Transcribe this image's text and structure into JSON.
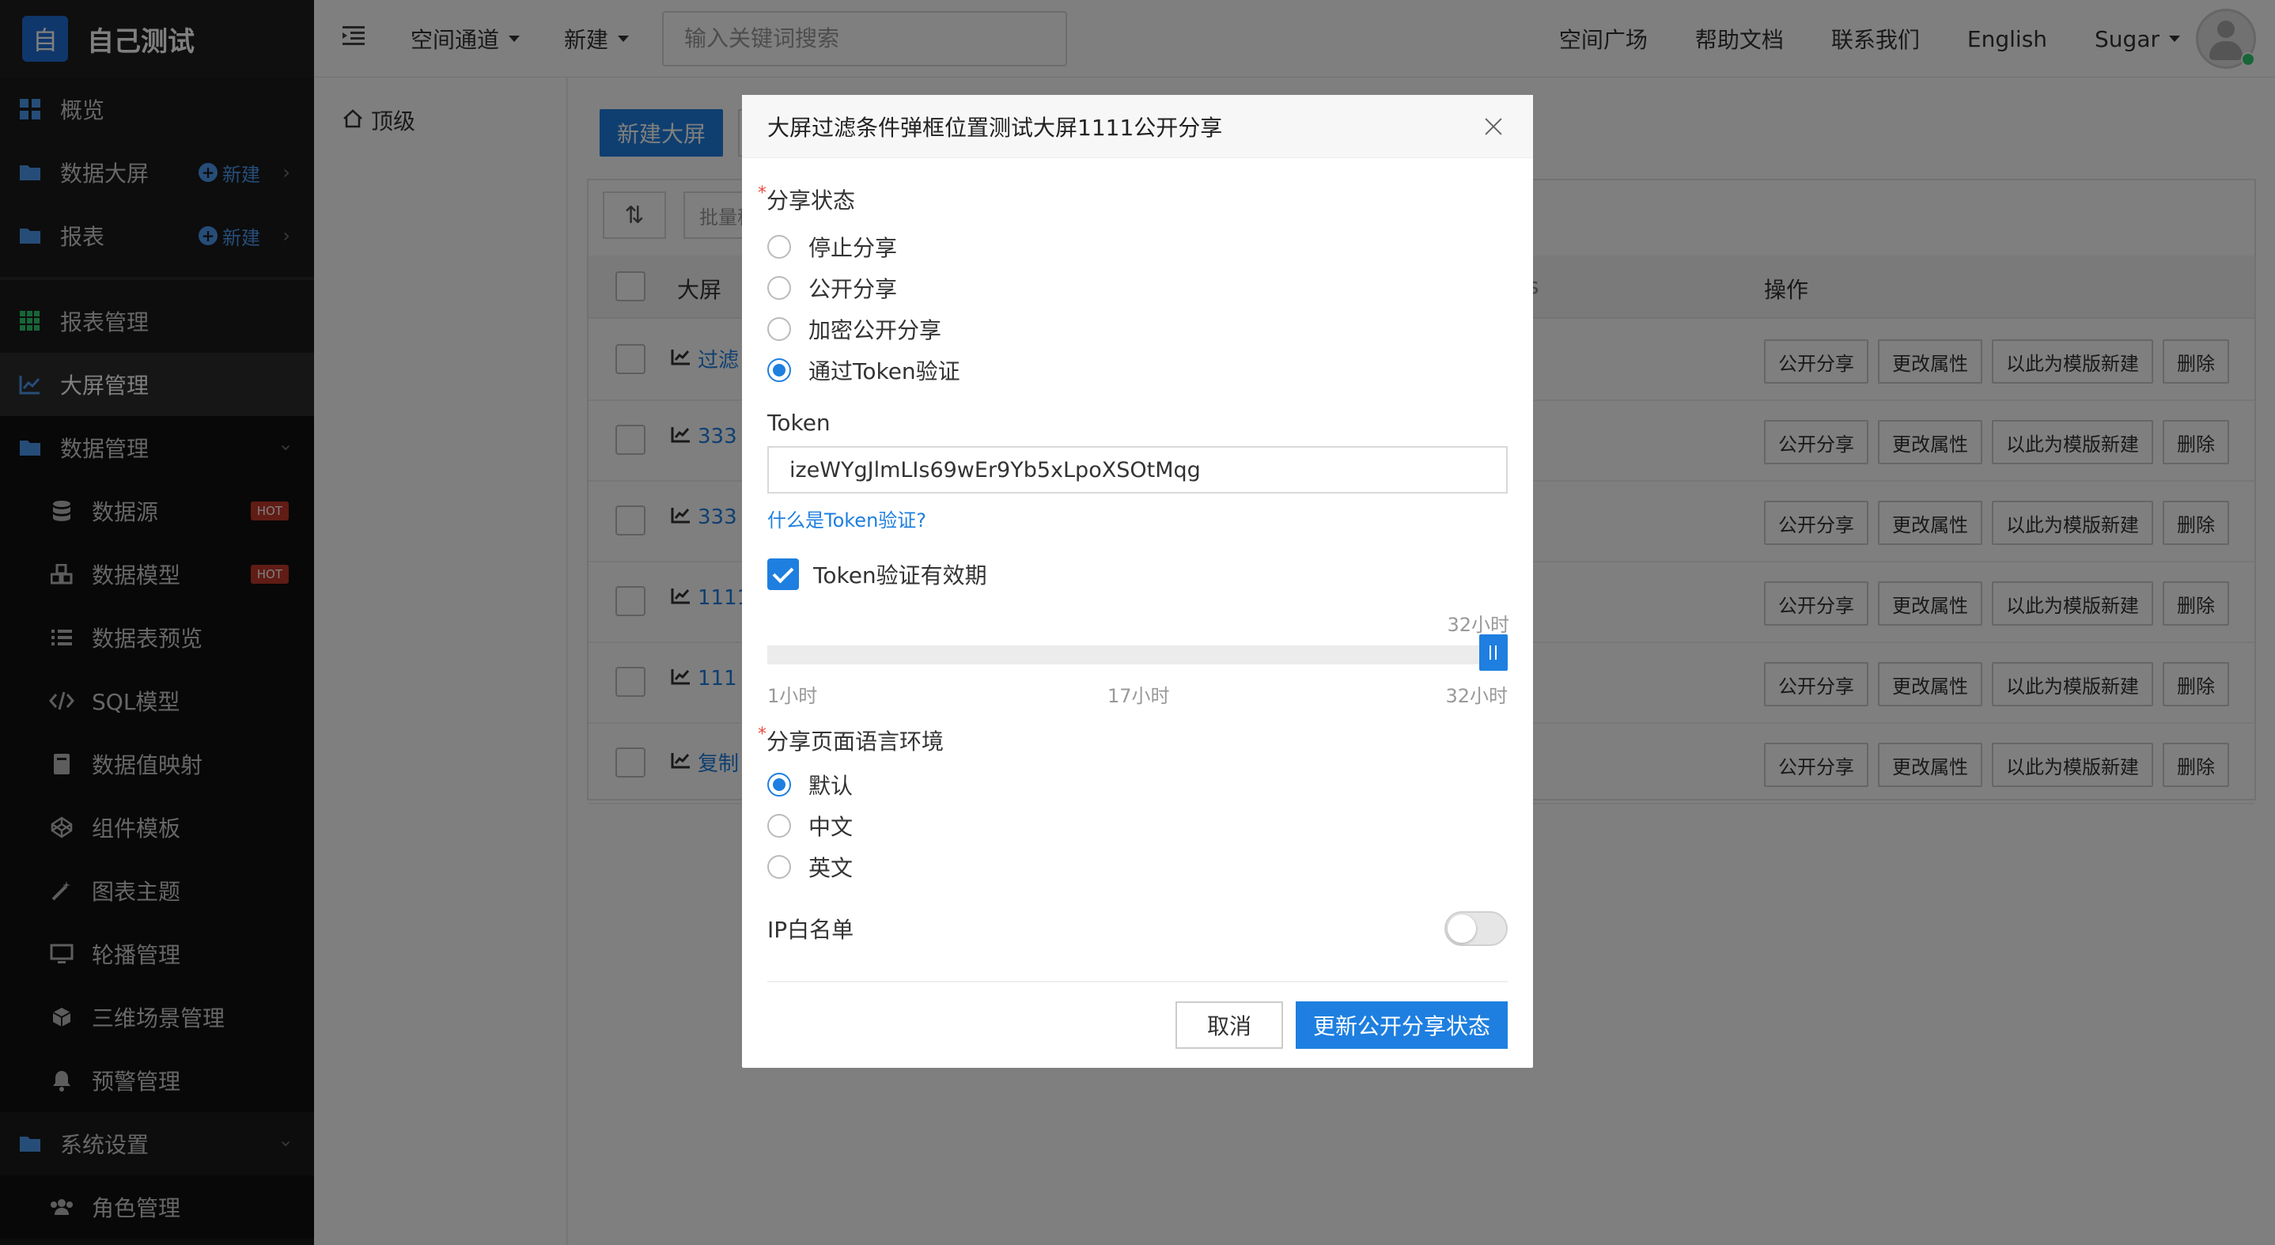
{
  "app": {
    "logo_char": "自",
    "name": "自己测试"
  },
  "sidebar": {
    "items": [
      {
        "label": "概览",
        "icon": "grid-icon"
      },
      {
        "label": "数据大屏",
        "icon": "folder-icon",
        "new_label": "新建"
      },
      {
        "label": "报表",
        "icon": "folder-icon",
        "new_label": "新建"
      },
      {
        "label": "报表管理",
        "icon": "apps-icon"
      },
      {
        "label": "大屏管理",
        "icon": "line-chart-icon",
        "active": true
      },
      {
        "label": "数据管理",
        "icon": "folder-icon"
      },
      {
        "label": "数据源",
        "icon": "database-icon",
        "badge": "HOT"
      },
      {
        "label": "数据模型",
        "icon": "cubes-icon",
        "badge": "HOT"
      },
      {
        "label": "数据表预览",
        "icon": "list-icon"
      },
      {
        "label": "SQL模型",
        "icon": "code-icon"
      },
      {
        "label": "数据值映射",
        "icon": "book-icon"
      },
      {
        "label": "组件模板",
        "icon": "codepen-icon"
      },
      {
        "label": "图表主题",
        "icon": "magic-icon"
      },
      {
        "label": "轮播管理",
        "icon": "monitor-icon"
      },
      {
        "label": "三维场景管理",
        "icon": "cube-icon"
      },
      {
        "label": "预警管理",
        "icon": "bell-icon"
      },
      {
        "label": "系统设置",
        "icon": "folder-icon"
      },
      {
        "label": "角色管理",
        "icon": "users-icon"
      }
    ]
  },
  "topbar": {
    "menu1": "空间通道",
    "menu2": "新建",
    "search_placeholder": "输入关键词搜索",
    "links": [
      "空间广场",
      "帮助文档",
      "联系我们",
      "English"
    ],
    "user": "Sugar"
  },
  "breadcrumb": {
    "label": "顶级"
  },
  "main": {
    "new_button": "新建大屏",
    "batch_placeholder": "批量移",
    "columns": {
      "name": "大屏",
      "ops": "操作",
      "partial": "s"
    },
    "rows": [
      {
        "name": "过滤"
      },
      {
        "name": "333"
      },
      {
        "name": "333"
      },
      {
        "name": "1111"
      },
      {
        "name": "111"
      },
      {
        "name": "复制"
      }
    ],
    "row_ops": [
      "公开分享",
      "更改属性",
      "以此为模版新建",
      "删除"
    ]
  },
  "modal": {
    "title": "大屏过滤条件弹框位置测试大屏1111公开分享",
    "share_status_label": "分享状态",
    "share_options": [
      {
        "label": "停止分享",
        "selected": false
      },
      {
        "label": "公开分享",
        "selected": false
      },
      {
        "label": "加密公开分享",
        "selected": false
      },
      {
        "label": "通过Token验证",
        "selected": true
      }
    ],
    "token_label": "Token",
    "token_value": "izeWYgJlmLIs69wEr9Yb5xLpoXSOtMqg",
    "token_help": "什么是Token验证?",
    "token_expiry_label": "Token验证有效期",
    "token_expiry_checked": true,
    "slider": {
      "min": 1,
      "mid": 17,
      "max": 32,
      "value": 32,
      "min_label": "1小时",
      "mid_label": "17小时",
      "max_label": "32小时",
      "value_label": "32小时"
    },
    "lang_label": "分享页面语言环境",
    "lang_options": [
      {
        "label": "默认",
        "selected": true
      },
      {
        "label": "中文",
        "selected": false
      },
      {
        "label": "英文",
        "selected": false
      }
    ],
    "ip_label": "IP白名单",
    "ip_enabled": false,
    "cancel": "取消",
    "submit": "更新公开分享状态",
    "colors": {
      "primary": "#1e7fe0",
      "required": "#e74c3c"
    }
  }
}
